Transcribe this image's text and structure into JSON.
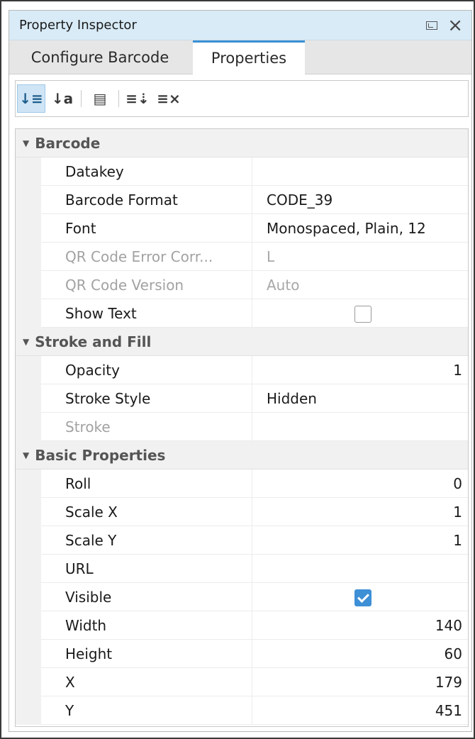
{
  "window": {
    "title": "Property Inspector",
    "restore_icon": "restore-window-icon",
    "close_icon": "close-icon"
  },
  "tabs": [
    {
      "label": "Configure Barcode",
      "active": false
    },
    {
      "label": "Properties",
      "active": true
    }
  ],
  "toolbar": {
    "buttons": [
      {
        "name": "sort-categorized-icon",
        "glyph": "↓≡",
        "active": true
      },
      {
        "name": "sort-alphabetical-icon",
        "glyph": "↓a",
        "active": false
      },
      {
        "name": "show-descriptions-icon",
        "glyph": "▤",
        "active": false
      },
      {
        "name": "expand-all-icon",
        "glyph": "≡⇣",
        "active": false
      },
      {
        "name": "collapse-all-icon",
        "glyph": "≡⨯",
        "active": false
      }
    ]
  },
  "sections": [
    {
      "title": "Barcode",
      "rows": [
        {
          "name": "Datakey",
          "value": "",
          "disabled": false,
          "type": "text"
        },
        {
          "name": "Barcode Format",
          "value": "CODE_39",
          "disabled": false,
          "type": "text"
        },
        {
          "name": "Font",
          "value": "Monospaced, Plain, 12",
          "disabled": false,
          "type": "text"
        },
        {
          "name": "QR Code Error Corr...",
          "value": "L",
          "disabled": true,
          "type": "text"
        },
        {
          "name": "QR Code Version",
          "value": "Auto",
          "disabled": true,
          "type": "text"
        },
        {
          "name": "Show Text",
          "value": false,
          "disabled": false,
          "type": "checkbox"
        }
      ]
    },
    {
      "title": "Stroke and Fill",
      "rows": [
        {
          "name": "Opacity",
          "value": "1",
          "disabled": false,
          "type": "number"
        },
        {
          "name": "Stroke Style",
          "value": "Hidden",
          "disabled": false,
          "type": "text"
        },
        {
          "name": "Stroke",
          "value": "",
          "disabled": true,
          "type": "text"
        }
      ]
    },
    {
      "title": "Basic Properties",
      "rows": [
        {
          "name": "Roll",
          "value": "0",
          "disabled": false,
          "type": "number"
        },
        {
          "name": "Scale X",
          "value": "1",
          "disabled": false,
          "type": "number"
        },
        {
          "name": "Scale Y",
          "value": "1",
          "disabled": false,
          "type": "number"
        },
        {
          "name": "URL",
          "value": "",
          "disabled": false,
          "type": "text"
        },
        {
          "name": "Visible",
          "value": true,
          "disabled": false,
          "type": "checkbox"
        },
        {
          "name": "Width",
          "value": "140",
          "disabled": false,
          "type": "number"
        },
        {
          "name": "Height",
          "value": "60",
          "disabled": false,
          "type": "number"
        },
        {
          "name": "X",
          "value": "179",
          "disabled": false,
          "type": "number"
        },
        {
          "name": "Y",
          "value": "451",
          "disabled": false,
          "type": "number"
        }
      ]
    }
  ],
  "colors": {
    "title_bar": "#d8ebf7",
    "active_tab_accent": "#3a8fd4",
    "checkbox_checked": "#3d8fd6",
    "disabled_text": "#a2a2a2"
  }
}
